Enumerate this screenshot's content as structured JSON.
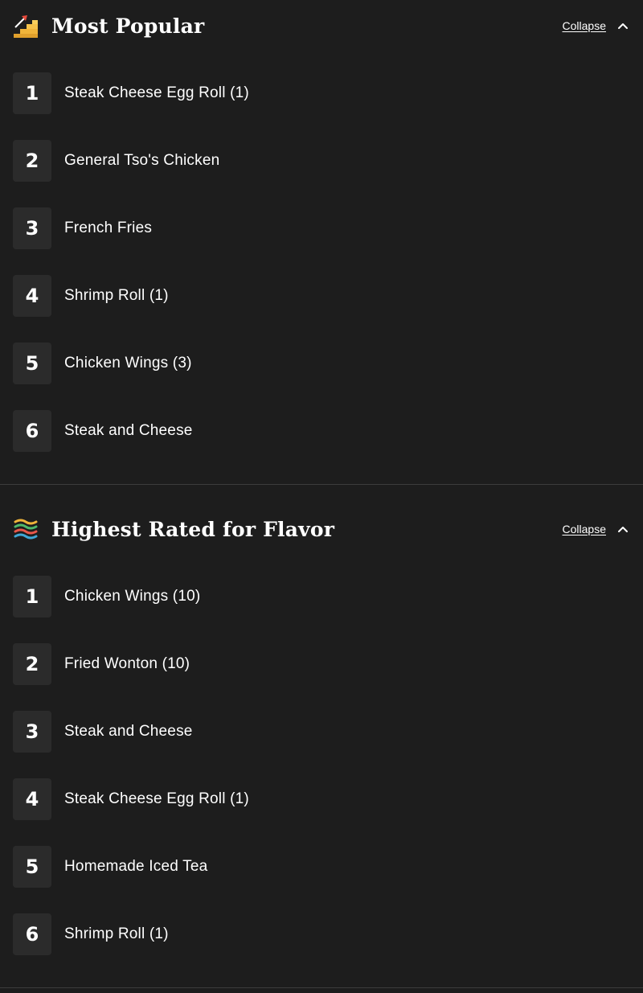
{
  "sections": [
    {
      "title": "Most Popular",
      "icon": "stairs-icon",
      "collapse_label": "Collapse",
      "items": [
        {
          "rank": "1",
          "name": "Steak Cheese Egg Roll (1)"
        },
        {
          "rank": "2",
          "name": "General Tso's Chicken"
        },
        {
          "rank": "3",
          "name": "French Fries"
        },
        {
          "rank": "4",
          "name": "Shrimp Roll (1)"
        },
        {
          "rank": "5",
          "name": "Chicken Wings (3)"
        },
        {
          "rank": "6",
          "name": "Steak and Cheese"
        }
      ]
    },
    {
      "title": "Highest Rated for Flavor",
      "icon": "flavor-waves-icon",
      "collapse_label": "Collapse",
      "items": [
        {
          "rank": "1",
          "name": "Chicken Wings (10)"
        },
        {
          "rank": "2",
          "name": "Fried Wonton (10)"
        },
        {
          "rank": "3",
          "name": "Steak and Cheese"
        },
        {
          "rank": "4",
          "name": "Steak Cheese Egg Roll (1)"
        },
        {
          "rank": "5",
          "name": "Homemade Iced Tea"
        },
        {
          "rank": "6",
          "name": "Shrimp Roll (1)"
        }
      ]
    }
  ],
  "colors": {
    "background": "#1d1d1d",
    "rank_badge": "#2b2b2b",
    "divider": "#3c3c3c",
    "text": "#ffffff"
  }
}
